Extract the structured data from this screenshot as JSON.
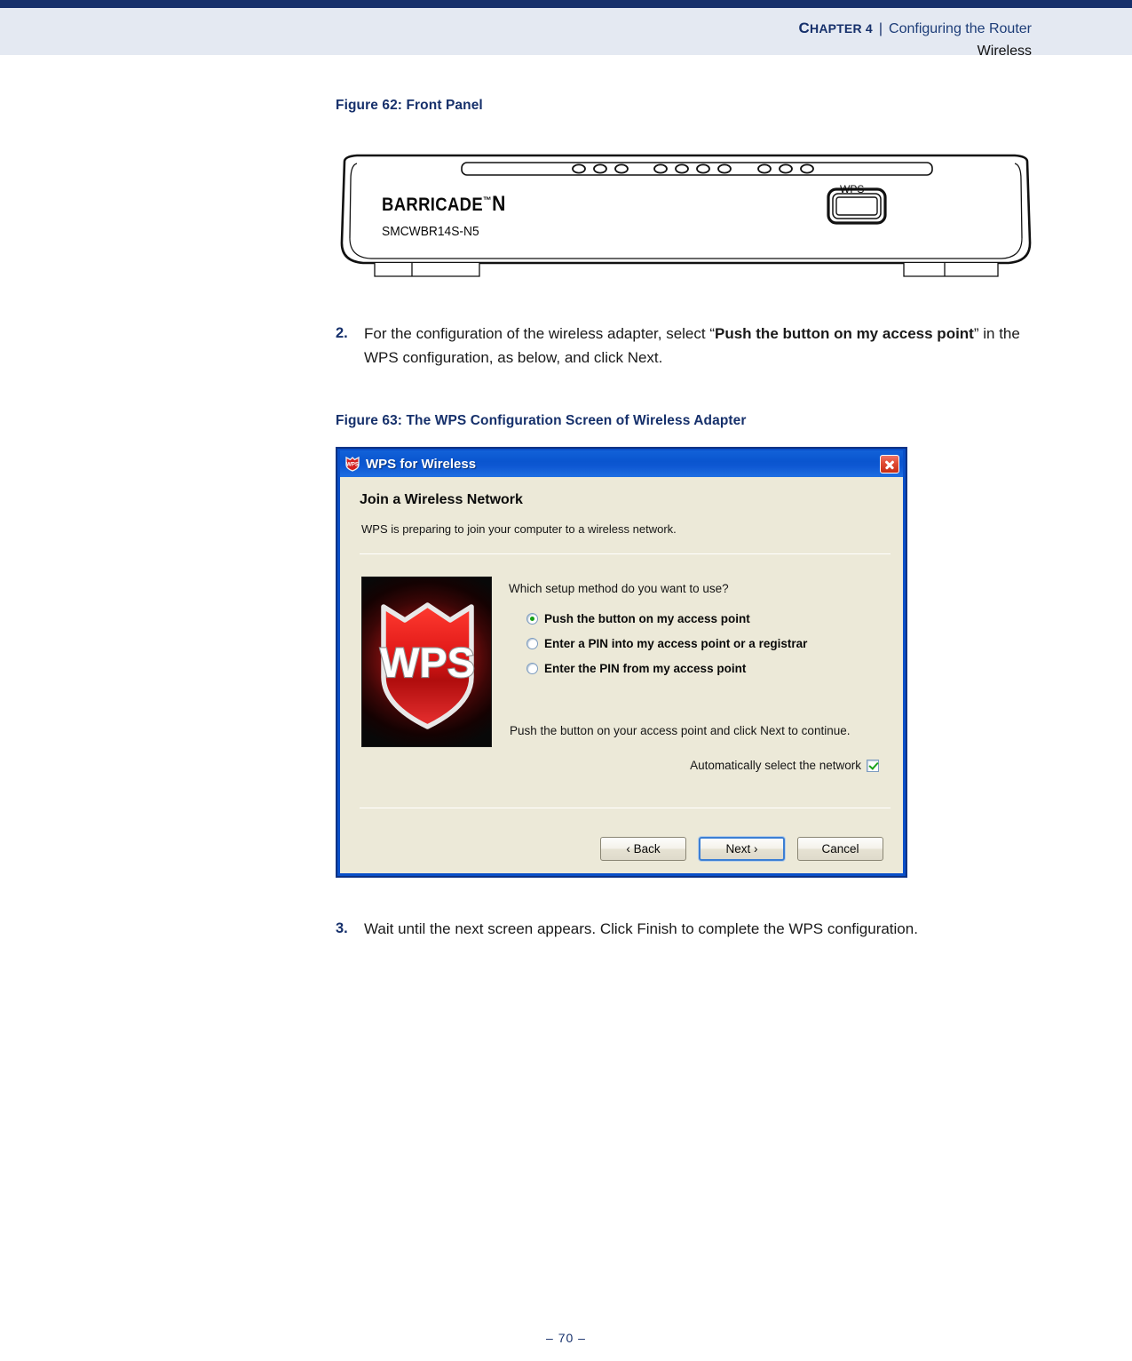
{
  "header": {
    "chapter_label": "Chapter 4",
    "chapter_prefix": "C",
    "chapter_rest": "HAPTER 4",
    "separator": "|",
    "title": "Configuring the Router",
    "subtitle": "Wireless",
    "rule_color": "#16306b",
    "band_color": "#e4e9f2",
    "accent_color": "#16306b"
  },
  "figures": {
    "fig62_caption": "Figure 62:  Front Panel",
    "fig63_caption": "Figure 63:  The WPS Configuration Screen of Wireless Adapter"
  },
  "router": {
    "brand": "BARRICADE",
    "brand_tm": "™",
    "brand_n": "N",
    "model": "SMCWBR14S-N5",
    "wps_label": "WPS",
    "led_groups": [
      3,
      4,
      3
    ]
  },
  "steps": [
    {
      "number": "2.",
      "segments": [
        {
          "text": "For the configuration of the wireless adapter, select “",
          "bold": false
        },
        {
          "text": "Push the button on my access point",
          "bold": true
        },
        {
          "text": "” in the WPS configuration, as below, and click Next.",
          "bold": false
        }
      ]
    },
    {
      "number": "3.",
      "segments": [
        {
          "text": "Wait until the next screen appears. Click Finish to complete the WPS configuration.",
          "bold": false
        }
      ]
    }
  ],
  "dialog": {
    "titlebar": {
      "title": "WPS for Wireless",
      "icon_name": "wps-shield-icon",
      "close_label": "Close",
      "bg_color": "#0a55cf"
    },
    "heading": "Join a Wireless Network",
    "subheading": "WPS is preparing to join your computer to a wireless network.",
    "logo_text": "WPS",
    "question": "Which setup method do you want to use?",
    "options": [
      {
        "label": "Push the button on my access point",
        "selected": true
      },
      {
        "label": "Enter a PIN into my access point or a registrar",
        "selected": false
      },
      {
        "label": "Enter the PIN from my access point",
        "selected": false
      }
    ],
    "hint": "Push the button on your access point and click Next to continue.",
    "auto_select": {
      "label": "Automatically select the network",
      "checked": true
    },
    "buttons": [
      {
        "label": "‹ Back",
        "default": false
      },
      {
        "label": "Next ›",
        "default": true
      },
      {
        "label": "Cancel",
        "default": false
      }
    ],
    "body_bg": "#ece9d8"
  },
  "footer": {
    "page_number": "–  70  –"
  }
}
